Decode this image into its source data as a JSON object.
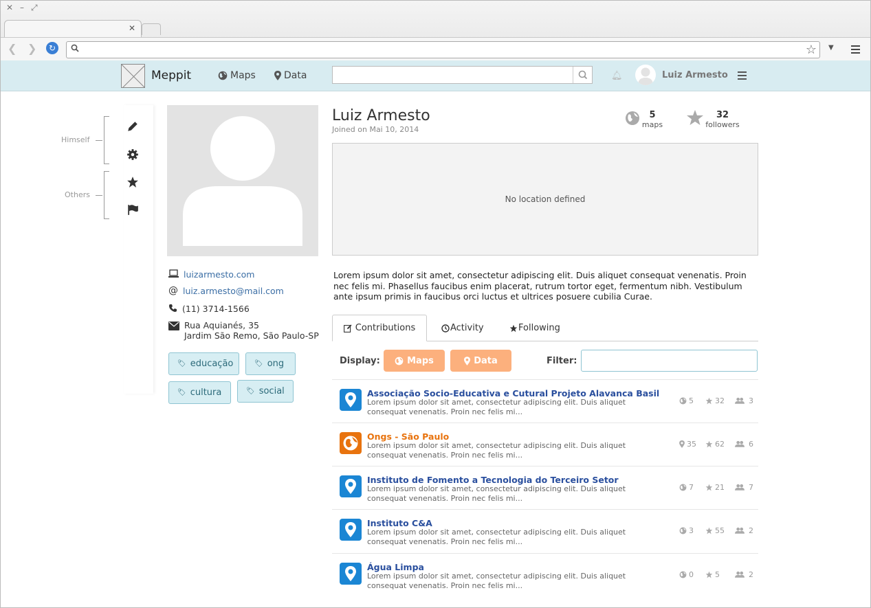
{
  "app": {
    "brand": "Meppit",
    "nav_maps": "Maps",
    "nav_data": "Data",
    "user_name": "Luiz Armesto"
  },
  "side_menu": {
    "group_himself": "Himself",
    "group_others": "Others"
  },
  "profile": {
    "name": "Luiz Armesto",
    "joined": "Joined on Mai 10, 2014",
    "website": "luizarmesto.com",
    "email": "luiz.armesto@mail.com",
    "phone": "(11) 3714-1566",
    "address_line1": "Rua Aquianés, 35",
    "address_line2": "Jardim São Remo, São Paulo-SP",
    "tags": [
      "educação",
      "ong",
      "cultura",
      "social"
    ],
    "maps_count": "5",
    "maps_label": "maps",
    "followers_count": "32",
    "followers_label": "followers",
    "location_placeholder": "No location defined",
    "bio": "Lorem ipsum dolor sit amet, consectetur adipiscing elit. Duis aliquet consequat venenatis. Proin nec felis mi. Phasellus faucibus enim placerat, rutrum tortor eget, fermentum nibh. Vestibulum ante ipsum primis in faucibus orci luctus et ultrices posuere cubilia Curae."
  },
  "tabs": {
    "contributions": "Contributions",
    "activity": "Activity",
    "following": "Following"
  },
  "filters": {
    "display_label": "Display:",
    "maps_btn": "Maps",
    "data_btn": "Data",
    "filter_label": "Filter:"
  },
  "colors": {
    "appbar": "#d8ecf1",
    "accent_orange": "#fcb07d",
    "link_blue": "#2a4f9e",
    "map_orange": "#e8730e",
    "data_blue": "#1b86d4"
  },
  "rows": [
    {
      "title": "Associação Socio-Educativa e Cutural Projeto Alavanca Basil",
      "desc": "Lorem ipsum dolor sit amet, consectetur adipiscing elit. Duis aliquet consequat venenatis. Proin nec felis mi...",
      "kind": "data",
      "s1": "5",
      "s2": "32",
      "s3": "3"
    },
    {
      "title": "Ongs - São Paulo",
      "desc": "Lorem ipsum dolor sit amet, consectetur adipiscing elit. Duis aliquet consequat venenatis. Proin nec felis mi...",
      "kind": "map",
      "s1": "35",
      "s2": "62",
      "s3": "6"
    },
    {
      "title": "Instituto de Fomento a Tecnologia do Terceiro Setor",
      "desc": "Lorem ipsum dolor sit amet, consectetur adipiscing elit. Duis aliquet consequat venenatis. Proin nec felis mi...",
      "kind": "data",
      "s1": "7",
      "s2": "21",
      "s3": "7"
    },
    {
      "title": "Instituto C&A",
      "desc": "Lorem ipsum dolor sit amet, consectetur adipiscing elit. Duis aliquet consequat venenatis. Proin nec felis mi...",
      "kind": "data",
      "s1": "3",
      "s2": "55",
      "s3": "2"
    },
    {
      "title": "Água Limpa",
      "desc": "Lorem ipsum dolor sit amet, consectetur adipiscing elit. Duis aliquet consequat venenatis. Proin nec felis mi...",
      "kind": "data",
      "s1": "0",
      "s2": "5",
      "s3": "2"
    }
  ]
}
